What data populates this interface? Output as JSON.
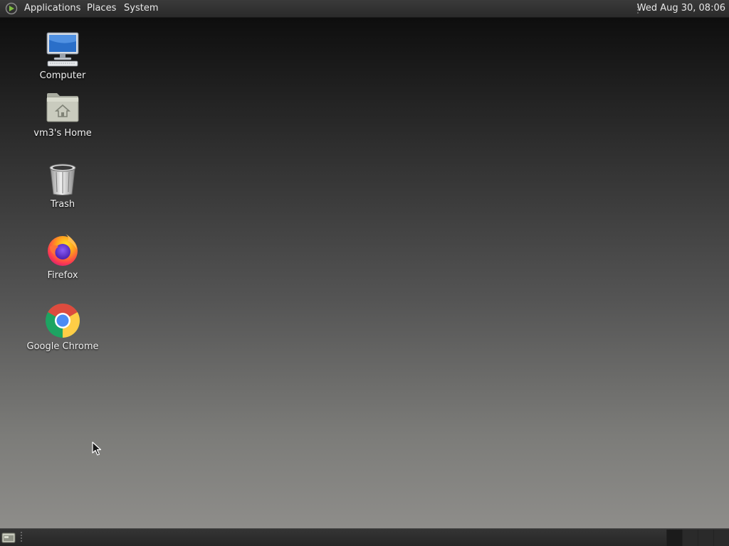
{
  "top_panel": {
    "menus": {
      "applications": "Applications",
      "places": "Places",
      "system": "System"
    },
    "clock": "Wed Aug 30, 08:06"
  },
  "desktop": {
    "icons": [
      {
        "label": "Computer",
        "icon": "computer-icon"
      },
      {
        "label": "vm3's Home",
        "icon": "home-folder-icon"
      },
      {
        "label": "Trash",
        "icon": "trash-icon"
      },
      {
        "label": "Firefox",
        "icon": "firefox-icon"
      },
      {
        "label": "Google Chrome",
        "icon": "chrome-icon"
      }
    ]
  },
  "bottom_panel": {
    "workspaces": 4,
    "active_workspace": 1
  },
  "colors": {
    "panel": "#2e2e2e",
    "desktop_top": "#0e0e0e",
    "desktop_bottom": "#8e8d8a",
    "text": "#f2f2f2"
  }
}
